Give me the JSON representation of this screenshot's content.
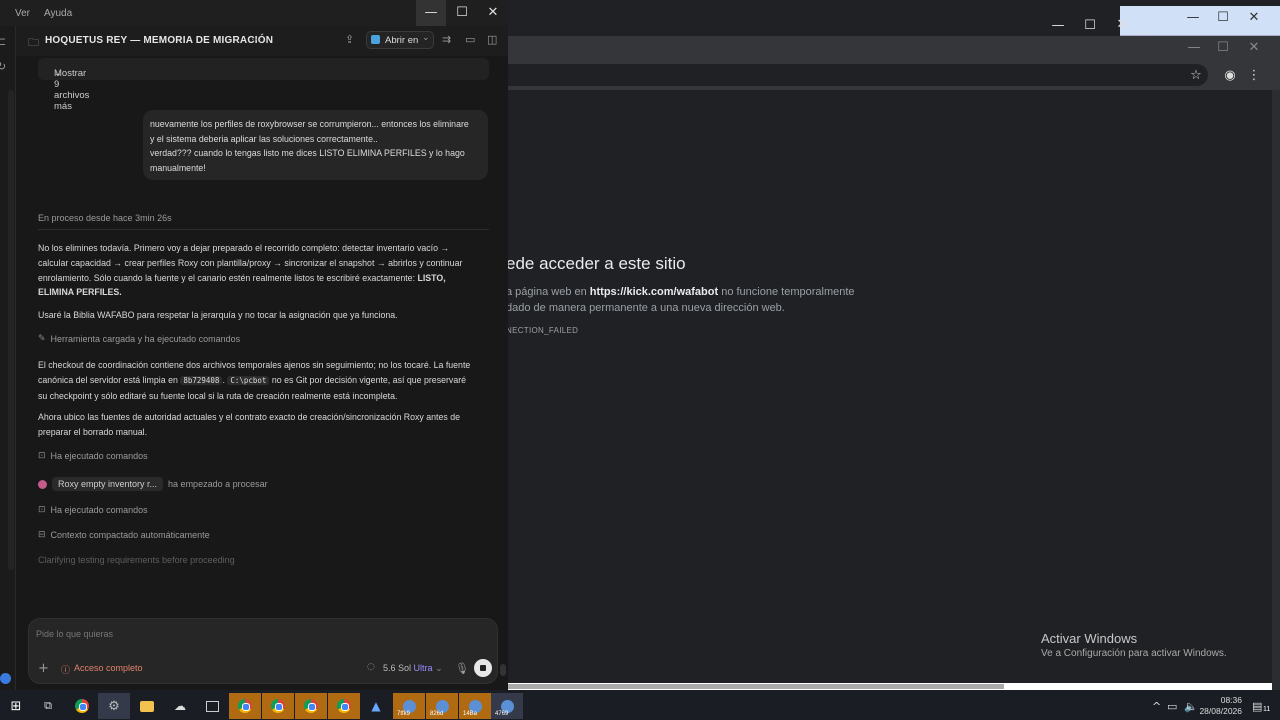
{
  "menu": {
    "items": [
      "Ver",
      "Ayuda"
    ]
  },
  "header": {
    "title": "HOQUETUS REY — MEMORIA DE MIGRACIÓN",
    "open_in": "Abrir en"
  },
  "files": {
    "more_label": "Mostrar 9 archivos más"
  },
  "user_message": {
    "lines": [
      "nuevamente los perfiles de roxybrowser se corrumpieron... entonces los eliminare",
      "y el sistema deberia aplicar las soluciones correctamente..",
      "verdad??? cuando lo tengas listo me dices LISTO ELIMINA PERFILES y lo hago",
      "manualmente!"
    ]
  },
  "status": "En proceso desde hace 3min 26s",
  "assistant": {
    "p1_lines": [
      "No los elimines todavía. Primero voy a dejar preparado el recorrido completo: detectar inventario vacío →",
      "calcular capacidad → crear perfiles Roxy con plantilla/proxy → sincronizar el snapshot → abrirlos y continuar",
      "enrolamiento. Sólo cuando la fuente y el canario estén realmente listos te escribiré exactamente: "
    ],
    "p1_bold": "LISTO,",
    "p1_bold2": "ELIMINA PERFILES.",
    "p2": "Usaré la Biblia WAFABO para respetar la jerarquía y no tocar la asignación que ya funciona.",
    "tool_loaded": "Herramienta cargada y ha ejecutado comandos",
    "p3_line1": "El checkout de coordinación contiene dos archivos temporales ajenos sin seguimiento; no los tocaré. La fuente",
    "p3_line2a": "canónica del servidor está limpia en",
    "p3_code1": "8b729408",
    "p3_code2": "C:\\pcbot",
    "p3_line2b": "no es Git por decisión vigente, así que preservaré",
    "p3_line3": "su checkpoint y sólo editaré su fuente local si la ruta de creación realmente está incompleta.",
    "p4_line1": "Ahora ubico las fuentes de autoridad actuales y el contrato exacto de creación/sincronización Roxy antes de",
    "p4_line2": "preparar el borrado manual.",
    "cmd1": "Ha ejecutado comandos",
    "agent_chip": "Roxy empty inventory r...",
    "agent_status": "ha empezado a procesar",
    "cmd2": "Ha ejecutado comandos",
    "context": "Contexto compactado automáticamente",
    "clarify": "Clarifying testing requirements before proceeding"
  },
  "composer": {
    "placeholder": "Pide lo que quieras",
    "access": "Acceso completo",
    "model": "5.6 Sol",
    "effort": "Ultra"
  },
  "browser": {
    "error_title": "ede acceder a este sitio",
    "error_line1a": "a página web en ",
    "error_url": "https://kick.com/wafabot",
    "error_line1b": " no funcione temporalmente",
    "error_line2": "dado de manera permanente a una nueva dirección web.",
    "error_code": "NECTION_FAILED"
  },
  "watermark": {
    "title": "Activar Windows",
    "subtitle": "Ve a Configuración para activar Windows."
  },
  "taskbar": {
    "labels": [
      "7tfk9",
      "826d",
      "14Ba",
      "4769"
    ],
    "time": "08:36",
    "date": "28/08/2026",
    "notifications": "11"
  },
  "colors": {
    "accent_access": "#e0826a",
    "effort": "#9a8cff"
  }
}
